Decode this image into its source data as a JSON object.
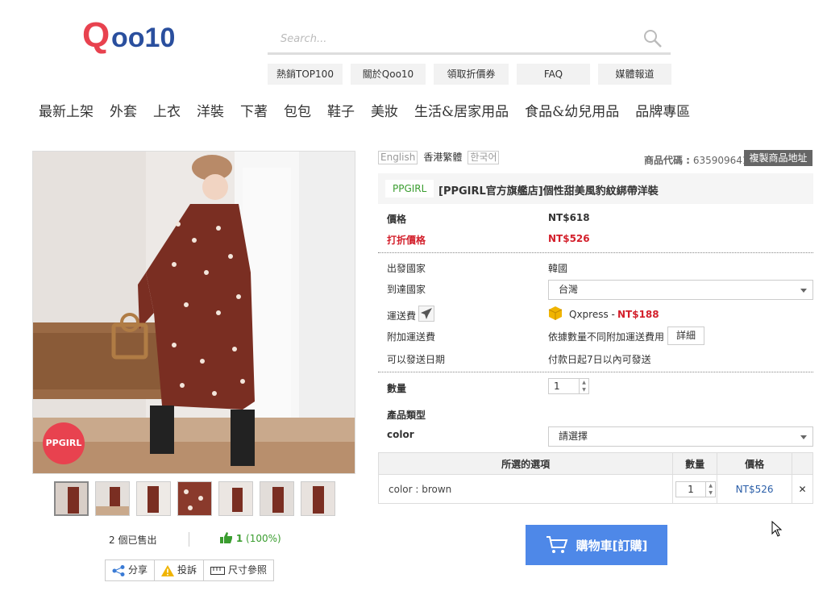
{
  "header": {
    "logo_text": "Qoo10",
    "search_placeholder": "Search...",
    "top_links": [
      "熱銷TOP100",
      "關於Qoo10",
      "領取折價券",
      "FAQ",
      "媒體報道"
    ]
  },
  "nav": [
    "最新上架",
    "外套",
    "上衣",
    "洋裝",
    "下著",
    "包包",
    "鞋子",
    "美妝",
    "生活&居家用品",
    "食品&幼兒用品",
    "品牌專區"
  ],
  "product": {
    "badge": "PPGIRL",
    "sold_text": "2 個已售出",
    "likes_count": "1",
    "likes_pct": "(100%)",
    "tools": [
      "分享",
      "投訴",
      "尺寸參照"
    ],
    "languages": [
      "English",
      "香港繁體",
      "한국어"
    ],
    "code_label": "商品代碼 :",
    "code_value": "635909641",
    "copy_button": "複製商品地址",
    "shop_tag": "PPGIRL",
    "title": "[PPGIRL官方旗艦店]個性甜美風豹紋綁帶洋裝",
    "price_label": "價格",
    "price_value": "NT$618",
    "discount_label": "打折價格",
    "discount_value": "NT$526",
    "origin_label": "出發國家",
    "origin_value": "韓國",
    "dest_label": "到達國家",
    "dest_value": "台灣",
    "ship_label": "運送費",
    "ship_carrier": "Qxpress -",
    "ship_fee": "NT$188",
    "extra_ship_label": "附加運送費",
    "extra_ship_text": "依據數量不同附加運送費用",
    "detail_button": "詳細",
    "ship_date_label": "可以發送日期",
    "ship_date_value": "付款日起7日以內可發送",
    "qty_label": "數量",
    "qty_value": "1",
    "type_label": "產品類型",
    "color_label": "color",
    "color_select": "請選擇",
    "table_headers": [
      "所選的選項",
      "數量",
      "價格"
    ],
    "selected_option": "color : brown",
    "selected_qty": "1",
    "selected_price": "NT$526",
    "remove_symbol": "✕",
    "cart_button": "購物車[訂購]"
  },
  "colors": {
    "brand_red": "#e8424f",
    "price_red": "#d31f2b",
    "cart_blue": "#4e88e8",
    "green": "#3a9d2f"
  }
}
